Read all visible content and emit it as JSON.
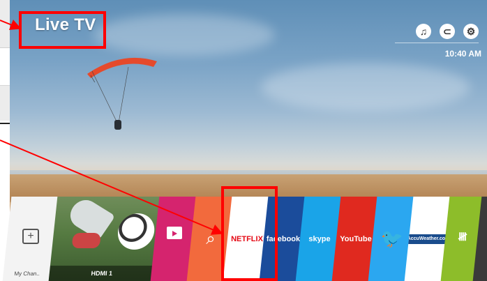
{
  "screen": {
    "title": "Live TV",
    "clock": "10:40 AM",
    "top_icons": [
      "music-note-icon",
      "input-switch-icon",
      "settings-gear-icon"
    ]
  },
  "launcher": {
    "items": [
      {
        "label": "My Chan..",
        "icon": "add-channel-icon"
      },
      {
        "label": "HDMI 1",
        "icon": "hdmi-input-thumbnail"
      },
      {
        "label": "",
        "icon": "lg-content-store-icon"
      },
      {
        "label": "",
        "icon": "search-icon"
      },
      {
        "label": "NETFLIX",
        "icon": "netflix-logo"
      },
      {
        "label": "facebook",
        "icon": "facebook-logo"
      },
      {
        "label": "skype",
        "icon": "skype-logo"
      },
      {
        "label": "YouTube",
        "icon": "youtube-logo"
      },
      {
        "label": "",
        "icon": "twitter-bird-icon"
      },
      {
        "label": "AccuWeather.com",
        "icon": "accuweather-logo"
      },
      {
        "label": "",
        "icon": "antenna-icon"
      }
    ]
  },
  "colors": {
    "annotation": "#ff0000",
    "netflix": "#e50914",
    "facebook": "#1b4c9b",
    "store": "#d5246e",
    "search": "#f26a3d",
    "skype": "#1aa4e8",
    "youtube": "#e0291f",
    "twitter": "#2ba7f0",
    "antenna": "#8dbd2a"
  }
}
